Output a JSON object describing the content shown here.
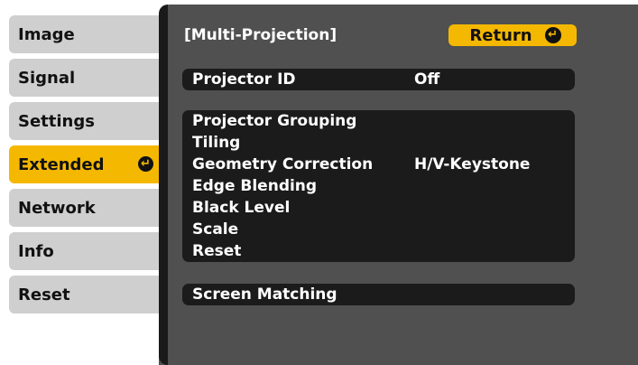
{
  "sidebar": {
    "items": [
      {
        "label": "Image"
      },
      {
        "label": "Signal"
      },
      {
        "label": "Settings"
      },
      {
        "label": "Extended"
      },
      {
        "label": "Network"
      },
      {
        "label": "Info"
      },
      {
        "label": "Reset"
      }
    ],
    "active_item": "Extended",
    "enter_icon": "enter-icon"
  },
  "panel": {
    "title": "[Multi-Projection]",
    "return_label": "Return",
    "return_icon": "enter-icon",
    "projector_id": {
      "label": "Projector ID",
      "value": "Off"
    },
    "group_items": [
      {
        "label": "Projector Grouping",
        "value": ""
      },
      {
        "label": "Tiling",
        "value": ""
      },
      {
        "label": "Geometry Correction",
        "value": "H/V-Keystone"
      },
      {
        "label": "Edge Blending",
        "value": ""
      },
      {
        "label": "Black Level",
        "value": ""
      },
      {
        "label": "Scale",
        "value": ""
      },
      {
        "label": "Reset",
        "value": ""
      }
    ],
    "screen_matching": {
      "label": "Screen Matching"
    }
  },
  "colors": {
    "accent": "#f5b800",
    "panel_bg": "#505050",
    "row_bg": "#1b1b1b",
    "sidebar_bg": "#cfcfcf"
  }
}
